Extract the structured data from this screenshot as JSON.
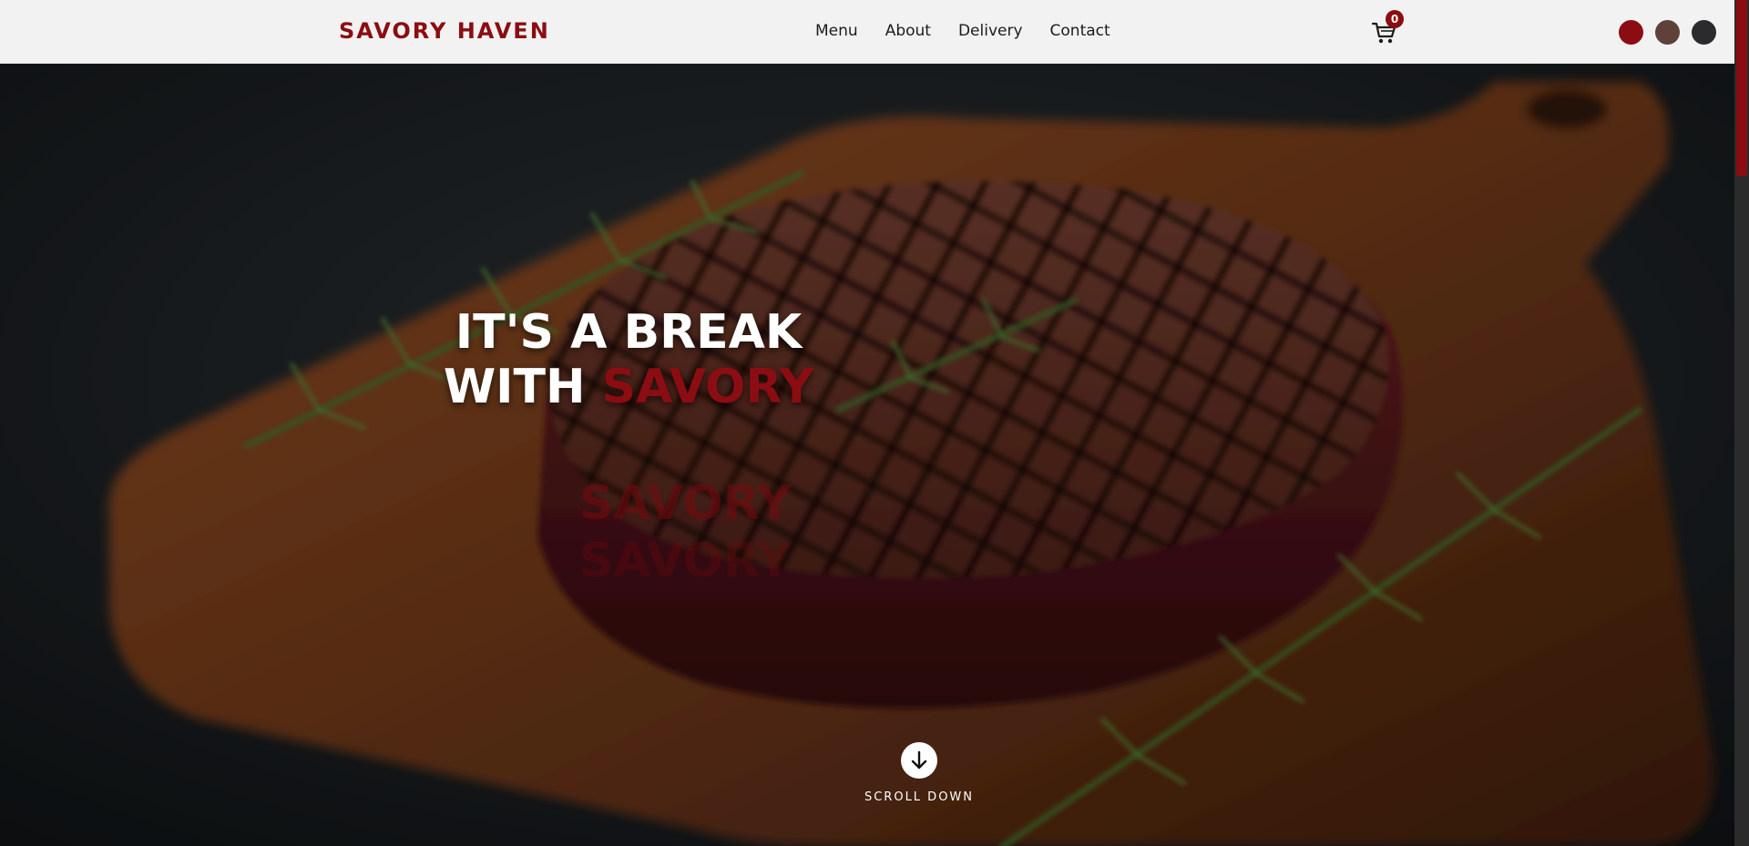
{
  "brand": {
    "name": "SAVORY HAVEN",
    "color": "#8b0d12"
  },
  "nav": {
    "items": [
      {
        "label": "Menu"
      },
      {
        "label": "About"
      },
      {
        "label": "Delivery"
      },
      {
        "label": "Contact"
      }
    ]
  },
  "cart": {
    "icon": "cart-icon",
    "count": "0"
  },
  "theme_swatches": [
    {
      "color": "#8b0d12"
    },
    {
      "color": "#5e4138"
    },
    {
      "color": "#2b2b2d"
    }
  ],
  "hero": {
    "headline_line1": "IT'S A BREAK",
    "headline_with": "WITH ",
    "headline_accent": "SAVORY",
    "ghost_words": [
      "SAVORY",
      "SAVORY"
    ],
    "image": "grilled-steak-on-cutting-board-with-rosemary",
    "scroll_icon": "arrow-down-icon",
    "scroll_label": "SCROLL DOWN"
  }
}
